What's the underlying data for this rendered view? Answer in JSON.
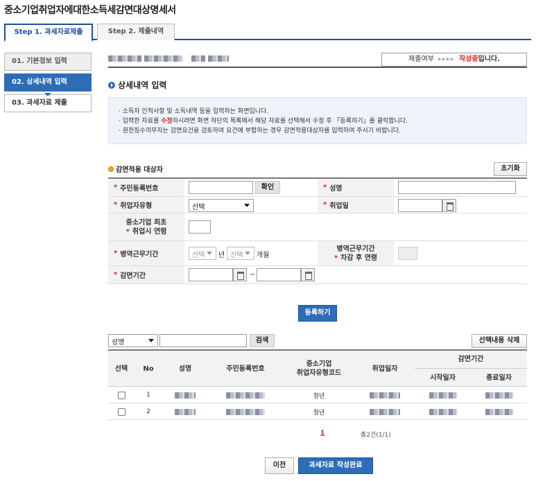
{
  "page": {
    "title": "중소기업취업자에대한소득세감면대상명세서"
  },
  "tabs": [
    {
      "label": "Step 1. 과세자료제출",
      "active": true
    },
    {
      "label": "Step 2. 제출내역",
      "active": false
    }
  ],
  "steps": [
    {
      "label": "01. 기본정보 입력",
      "state": "inactive"
    },
    {
      "label": "02. 상세내역 입력",
      "state": "active"
    },
    {
      "label": "03. 과세자료 제출",
      "state": "done"
    }
  ],
  "status": {
    "label": "제출여부",
    "arrows": "▸▸▸▸",
    "value": "작성중",
    "suffix": "입니다."
  },
  "section": {
    "title": "상세내역 입력"
  },
  "guide": {
    "line1": "· 소득자 인적사항 및 소득내역 등을 입력하는 화면입니다.",
    "line2_pre": "· 입력한 자료를 ",
    "line2_em": "수정",
    "line2_post": "하시려면 화면 하단의 목록에서 해당 자료를 선택해서 수정 후 「등록하기」를 클릭합니다.",
    "line3": "· 원천징수의무자는 감면요건을 검토하여 요건에 부합하는 경우 감면적용대상자를 입력하여 주시기 바랍니다."
  },
  "form": {
    "title": "감면적용 대상자",
    "reset_label": "초기화",
    "rrn_label": "주민등록번호",
    "confirm_label": "확인",
    "name_label": "성명",
    "type_label": "취업자유형",
    "type_value": "선택",
    "hire_label": "취업일",
    "age_label_1": "중소기업 최초",
    "age_label_2": "취업시 연령",
    "mil_label": "병역근무기간",
    "mil_year_value": "선택",
    "mil_year_unit": "년",
    "mil_month_value": "선택",
    "mil_month_unit": "개월",
    "mil_age_label_1": "병역근무기간",
    "mil_age_label_2": "차감 후 연령",
    "period_label": "감면기간",
    "period_sep": "~",
    "register_label": "등록하기"
  },
  "search": {
    "field_value": "성명",
    "search_label": "검색",
    "delete_label": "선택내용 삭제"
  },
  "table": {
    "headers": {
      "select": "선택",
      "no": "No",
      "name": "성명",
      "rrn": "주민등록번호",
      "type_1": "중소기업",
      "type_2": "취업자유형코드",
      "hire": "취업일자",
      "period": "감면기간",
      "start": "시작일자",
      "end": "종료일자"
    },
    "rows": [
      {
        "no": "1",
        "type": "청년"
      },
      {
        "no": "2",
        "type": "청년"
      }
    ]
  },
  "pagination": {
    "current": "1",
    "total": "총2건(1/1)"
  },
  "footer": {
    "prev_label": "이전",
    "complete_label": "과세자료 작성완료"
  }
}
